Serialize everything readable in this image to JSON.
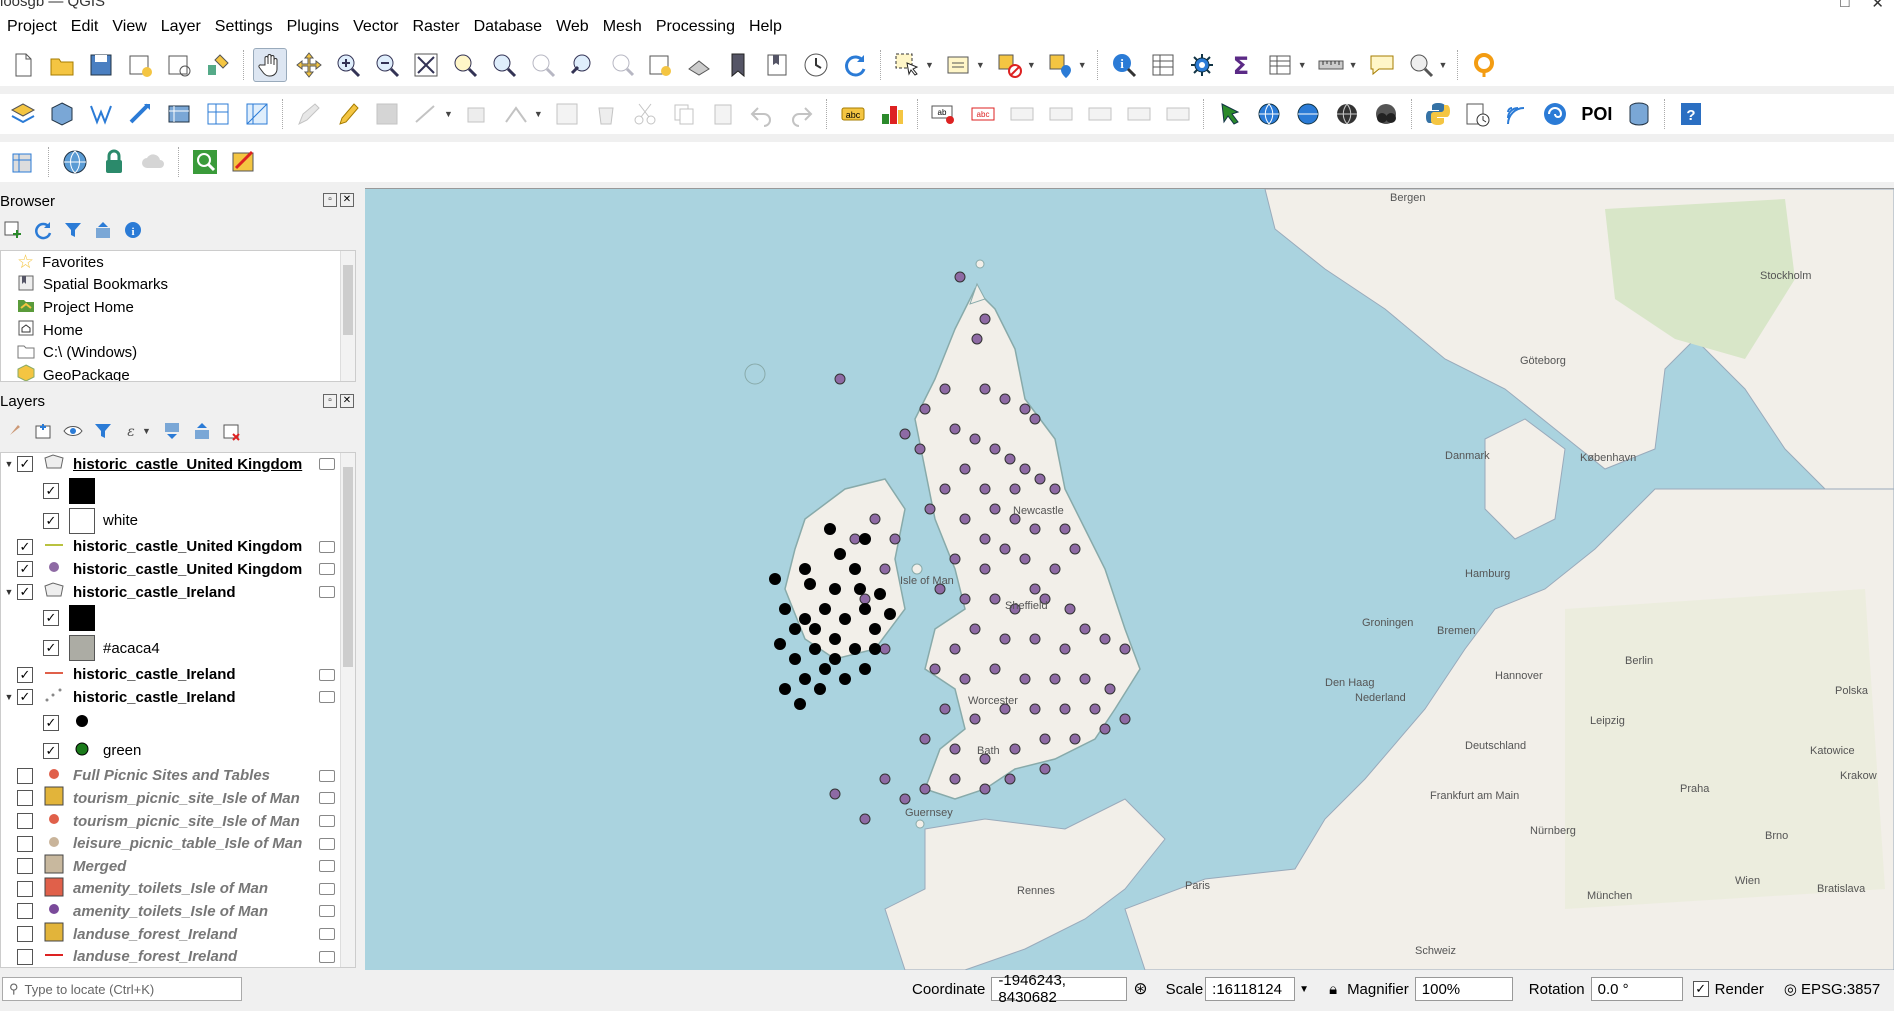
{
  "window": {
    "title": "loosgb — QGIS",
    "controls": [
      "□",
      "✕"
    ]
  },
  "menu": [
    "Project",
    "Edit",
    "View",
    "Layer",
    "Settings",
    "Plugins",
    "Vector",
    "Raster",
    "Database",
    "Web",
    "Mesh",
    "Processing",
    "Help"
  ],
  "toolbar_poi_label": "POI",
  "browser": {
    "title": "Browser",
    "items": [
      "Favorites",
      "Spatial Bookmarks",
      "Project Home",
      "Home",
      "C:\\ (Windows)",
      "GeoPackage"
    ]
  },
  "layers": {
    "title": "Layers",
    "rows": [
      {
        "label": "historic_castle_United Kingdom"
      },
      {
        "label": ""
      },
      {
        "label": "white"
      },
      {
        "label": "historic_castle_United Kingdom"
      },
      {
        "label": "historic_castle_United Kingdom"
      },
      {
        "label": "historic_castle_Ireland"
      },
      {
        "label": ""
      },
      {
        "label": "#acaca4"
      },
      {
        "label": "historic_castle_Ireland"
      },
      {
        "label": "historic_castle_Ireland"
      },
      {
        "label": ""
      },
      {
        "label": "green"
      },
      {
        "label": "Full Picnic Sites and Tables"
      },
      {
        "label": "tourism_picnic_site_Isle of Man"
      },
      {
        "label": "tourism_picnic_site_Isle of Man"
      },
      {
        "label": "leisure_picnic_table_Isle of Man"
      },
      {
        "label": "Merged"
      },
      {
        "label": "amenity_toilets_Isle of Man"
      },
      {
        "label": "amenity_toilets_Isle of Man"
      },
      {
        "label": "landuse_forest_Ireland"
      },
      {
        "label": "landuse_forest_Ireland"
      }
    ]
  },
  "map": {
    "labels": [
      "Bergen",
      "Stockholm",
      "Göteborg",
      "Danmark",
      "København",
      "Newcastle",
      "Isle of Man",
      "Sheffield",
      "Worcester",
      "Bath",
      "Hamburg",
      "Groningen",
      "Bremen",
      "Den Haag",
      "Nederland",
      "Hannover",
      "Berlin",
      "Polska",
      "Leipzig",
      "Deutschland",
      "Frankfurt am Main",
      "Praha",
      "Nürnberg",
      "Guernsey",
      "Rennes",
      "Paris",
      "München",
      "Brno",
      "Krakow",
      "Katowice",
      "Wien",
      "Bratislava",
      "Schweiz"
    ]
  },
  "status": {
    "locate_placeholder": "Type to locate (Ctrl+K)",
    "coordinate_label": "Coordinate",
    "coordinate_value": "-1946243, 8430682",
    "scale_label": "Scale",
    "scale_value": ":16118124",
    "magnifier_label": "Magnifier",
    "magnifier_value": "100%",
    "rotation_label": "Rotation",
    "rotation_value": "0.0 °",
    "render_label": "Render",
    "crs": "EPSG:3857"
  }
}
